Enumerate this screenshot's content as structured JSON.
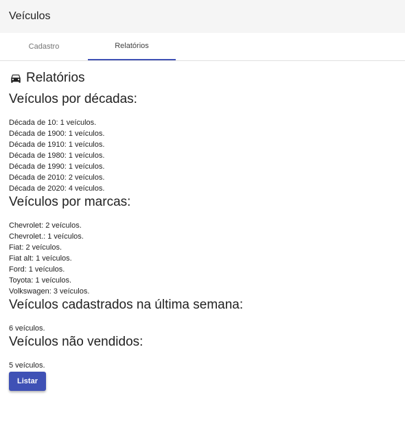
{
  "app": {
    "title": "Veículos"
  },
  "tabs": [
    {
      "label": "Cadastro",
      "active": false
    },
    {
      "label": "Relatórios",
      "active": true
    }
  ],
  "page": {
    "title": "Relatórios",
    "icon": "car-icon"
  },
  "sections": {
    "decades": {
      "title": "Veículos por décadas:",
      "items": [
        "Década de 10: 1 veículos.",
        "Década de 1900: 1 veículos.",
        "Década de 1910: 1 veículos.",
        "Década de 1980: 1 veículos.",
        "Década de 1990: 1 veículos.",
        "Década de 2010: 2 veículos.",
        "Década de 2020: 4 veículos."
      ]
    },
    "brands": {
      "title": "Veículos por marcas:",
      "items": [
        "Chevrolet: 2 veículos.",
        "Chevrolet.: 1 veículos.",
        "Fiat: 2 veículos.",
        "Fiat alt: 1 veículos.",
        "Ford: 1 veículos.",
        "Toyota: 1 veículos.",
        "Volkswagen: 3 veículos."
      ]
    },
    "last_week": {
      "title": "Veículos cadastrados na última semana:",
      "value": "6 veículos."
    },
    "unsold": {
      "title": "Veículos não vendidos:",
      "value": "5 veículos."
    }
  },
  "actions": {
    "list_label": "Listar"
  },
  "colors": {
    "primary": "#3f51b5",
    "toolbar_bg": "#f5f5f5"
  }
}
